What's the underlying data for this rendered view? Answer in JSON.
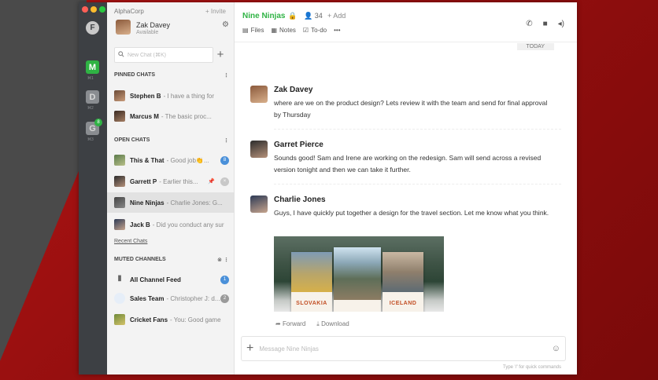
{
  "colors": {
    "accent": "#2fb344",
    "badge_blue": "#4a90d9",
    "badge_gray": "#9a9a9a"
  },
  "rail": {
    "logo": "F",
    "workspaces": [
      {
        "letter": "M",
        "sub": "⌘1",
        "color": "#2fb344"
      },
      {
        "letter": "D",
        "sub": "⌘2",
        "color": "#8a8d91"
      },
      {
        "letter": "G",
        "sub": "⌘3",
        "color": "#8a8d91",
        "badge": "8"
      }
    ]
  },
  "sidebar": {
    "org": "AlphaCorp",
    "invite": "+ Invite",
    "user": {
      "name": "Zak Davey",
      "status": "Available"
    },
    "search_placeholder": "New Chat (⌘K)",
    "pinned_header": "PINNED CHATS",
    "pinned": [
      {
        "name": "Stephen B",
        "preview": "- I have a thing for"
      },
      {
        "name": "Marcus M",
        "preview": "- The basic proc..."
      }
    ],
    "open_header": "OPEN CHATS",
    "open": [
      {
        "name": "This & That",
        "preview": "- Good job👏...",
        "count": "8"
      },
      {
        "name": "Garrett P",
        "preview": "- Earlier this..."
      },
      {
        "name": "Nine Ninjas",
        "preview": "- Charlie Jones: G..."
      },
      {
        "name": "Jack B",
        "preview": "- Did you conduct any sur"
      }
    ],
    "recent_link": "Recent Chats",
    "muted_header": "MUTED CHANNELS",
    "muted": [
      {
        "name": "All Channel Feed",
        "preview": "",
        "count": "1"
      },
      {
        "name": "Sales Team",
        "preview": "- Christopher J: d...",
        "count": "2"
      },
      {
        "name": "Cricket Fans",
        "preview": "- You: Good game"
      }
    ]
  },
  "main": {
    "title": "Nine Ninjas",
    "members": "34",
    "add": "+ Add",
    "tabs": [
      "Files",
      "Notes",
      "To-do"
    ],
    "more": "•••",
    "today": "TODAY",
    "messages": [
      {
        "author": "Zak Davey",
        "text": "where are we on the product design? Lets review it with the team and send for final approval by Thursday"
      },
      {
        "author": "Garret Pierce",
        "text": "Sounds good! Sam and Irene are working on the redesign. Sam will send across a revised version tonight and then we can take it further."
      },
      {
        "author": "Charlie Jones",
        "text": "Guys, I have quickly put together a design for the travel section. Let me know what you think."
      }
    ],
    "cards": [
      "SLOVAKIA",
      "ICELAND"
    ],
    "forward": "Forward",
    "download": "Download",
    "composer_placeholder": "Message Nine Ninjas",
    "hint": "Type '/' for quick commands"
  }
}
